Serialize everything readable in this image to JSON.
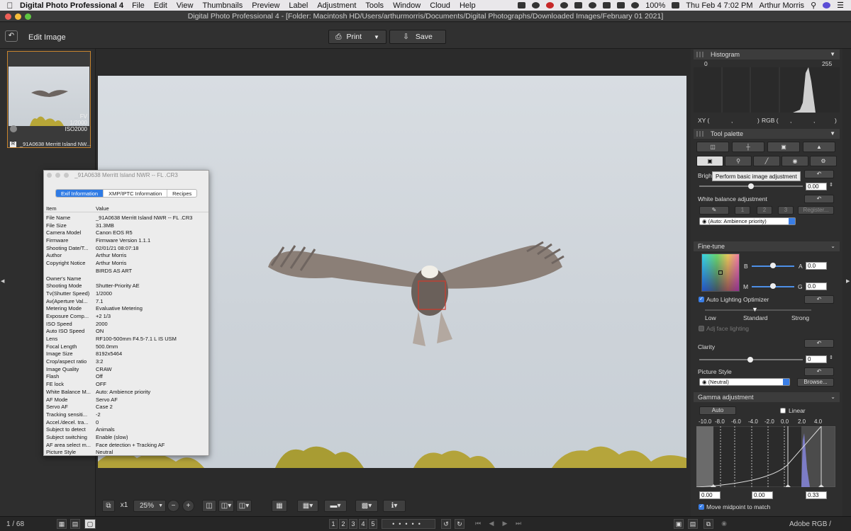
{
  "menubar": {
    "app_name": "Digital Photo Professional 4",
    "menus": [
      "File",
      "Edit",
      "View",
      "Thumbnails",
      "Preview",
      "Label",
      "Adjustment",
      "Tools",
      "Window",
      "Cloud",
      "Help"
    ],
    "battery": "100%",
    "clock": "Thu Feb 4  7:02 PM",
    "user": "Arthur Morris"
  },
  "window": {
    "title": "Digital Photo Professional 4 - [Folder: Macintosh HD/Users/arthurmorris/Documents/Digital Photographs/Downloaded Images/February 01 2021]"
  },
  "toolbar": {
    "mode_label": "Edit Image",
    "print_label": "Print",
    "save_label": "Save"
  },
  "thumbnail": {
    "shutter": "1/2000",
    "iso": "ISO2000",
    "fv": "FV",
    "badge": "R",
    "caption": "_91A0638  Merritt Island NW..."
  },
  "info_window": {
    "title": "_91A0638  Merritt Island NWR -- FL .CR3",
    "tabs": [
      "Exif Information",
      "XMP/IPTC Information",
      "Recipes"
    ],
    "col_item": "Item",
    "col_value": "Value",
    "rows": [
      {
        "k": "File Name",
        "v": "_91A0638  Merritt Island NWR -- FL .CR3"
      },
      {
        "k": "File Size",
        "v": "31.3MB"
      },
      {
        "k": "Camera Model",
        "v": "Canon EOS R5"
      },
      {
        "k": "Firmware",
        "v": "Firmware Version 1.1.1"
      },
      {
        "k": "Shooting Date/T...",
        "v": "02/01/21 08:07:18"
      },
      {
        "k": "Author",
        "v": "Arthur Morris"
      },
      {
        "k": "Copyright Notice",
        "v": "Arthur Morris"
      },
      {
        "k": "",
        "v": "BIRDS AS ART"
      },
      {
        "k": "Owner's Name",
        "v": ""
      },
      {
        "k": "Shooting Mode",
        "v": "Shutter-Priority AE"
      },
      {
        "k": "Tv(Shutter Speed)",
        "v": "1/2000"
      },
      {
        "k": "Av(Aperture Val...",
        "v": "7.1"
      },
      {
        "k": "Metering Mode",
        "v": "Evaluative Metering"
      },
      {
        "k": "Exposure Comp...",
        "v": "+2 1/3"
      },
      {
        "k": "ISO Speed",
        "v": "2000"
      },
      {
        "k": "Auto ISO Speed",
        "v": "ON"
      },
      {
        "k": "Lens",
        "v": "RF100-500mm F4.5-7.1 L IS USM"
      },
      {
        "k": "Focal Length",
        "v": "500.0mm"
      },
      {
        "k": "Image Size",
        "v": "8192x5464"
      },
      {
        "k": "Crop/aspect ratio",
        "v": "3:2"
      },
      {
        "k": "Image Quality",
        "v": "CRAW"
      },
      {
        "k": "Flash",
        "v": "Off"
      },
      {
        "k": "FE lock",
        "v": "OFF"
      },
      {
        "k": "White Balance M...",
        "v": "Auto: Ambience priority"
      },
      {
        "k": "AF Mode",
        "v": "Servo AF"
      },
      {
        "k": "Servo AF",
        "v": "Case 2"
      },
      {
        "k": "Tracking sensiti...",
        "v": "-2"
      },
      {
        "k": "Accel./decel. tra...",
        "v": "0"
      },
      {
        "k": "Subject to detect",
        "v": "Animals"
      },
      {
        "k": "Subject switching",
        "v": "Enable (slow)"
      },
      {
        "k": "AF area select m...",
        "v": "Face detection + Tracking AF"
      },
      {
        "k": "Picture Style",
        "v": "Neutral"
      }
    ]
  },
  "view_tools": {
    "zoom_x1": "x1",
    "zoom_value": "25%",
    "zoom_out": "−",
    "zoom_in": "+"
  },
  "status": {
    "count": "1 / 68",
    "ratings": [
      "1",
      "2",
      "3",
      "4",
      "5"
    ],
    "color_space": "Adobe RGB / sRGB"
  },
  "histogram": {
    "title": "Histogram",
    "min": "0",
    "max": "255",
    "xy_label": "XY (",
    "xy_sep": ",",
    "xy_close": ")",
    "rgb_label": "RGB (",
    "rgb_close": ")"
  },
  "tool_palette": {
    "title": "Tool palette",
    "tooltip": "Perform basic image adjustment",
    "brightness_label": "Bright",
    "brightness_value": "0.00",
    "brightness_level": 0.5,
    "wb_label": "White balance adjustment",
    "wb_slots": [
      "1",
      "2",
      "3"
    ],
    "register_label": "Register...",
    "wb_mode": "(Auto: Ambience priority)"
  },
  "fine_tune": {
    "title": "Fine-tune",
    "b_label": "B",
    "a_label": "A",
    "a_value": "0.0",
    "m_label": "M",
    "g_label": "G",
    "g_value": "0.0",
    "alo_label": "Auto Lighting Optimizer",
    "alo_checked": true,
    "alo_levels": [
      "Low",
      "Standard",
      "Strong"
    ],
    "face_label": "Adj face lighting",
    "clarity_label": "Clarity",
    "clarity_value": "0",
    "picture_style_label": "Picture Style",
    "picture_style_value": "(Neutral)",
    "browse_label": "Browse..."
  },
  "gamma": {
    "title": "Gamma adjustment",
    "auto_label": "Auto",
    "linear_label": "Linear",
    "scale": [
      "-10.0",
      "-8.0",
      "-6.0",
      "-4.0",
      "-2.0",
      "0.0",
      "2.0",
      "4.0"
    ],
    "left_value": "0.00",
    "mid_value": "0.00",
    "right_value": "0.33",
    "midpoint_label": "Move midpoint to match"
  }
}
